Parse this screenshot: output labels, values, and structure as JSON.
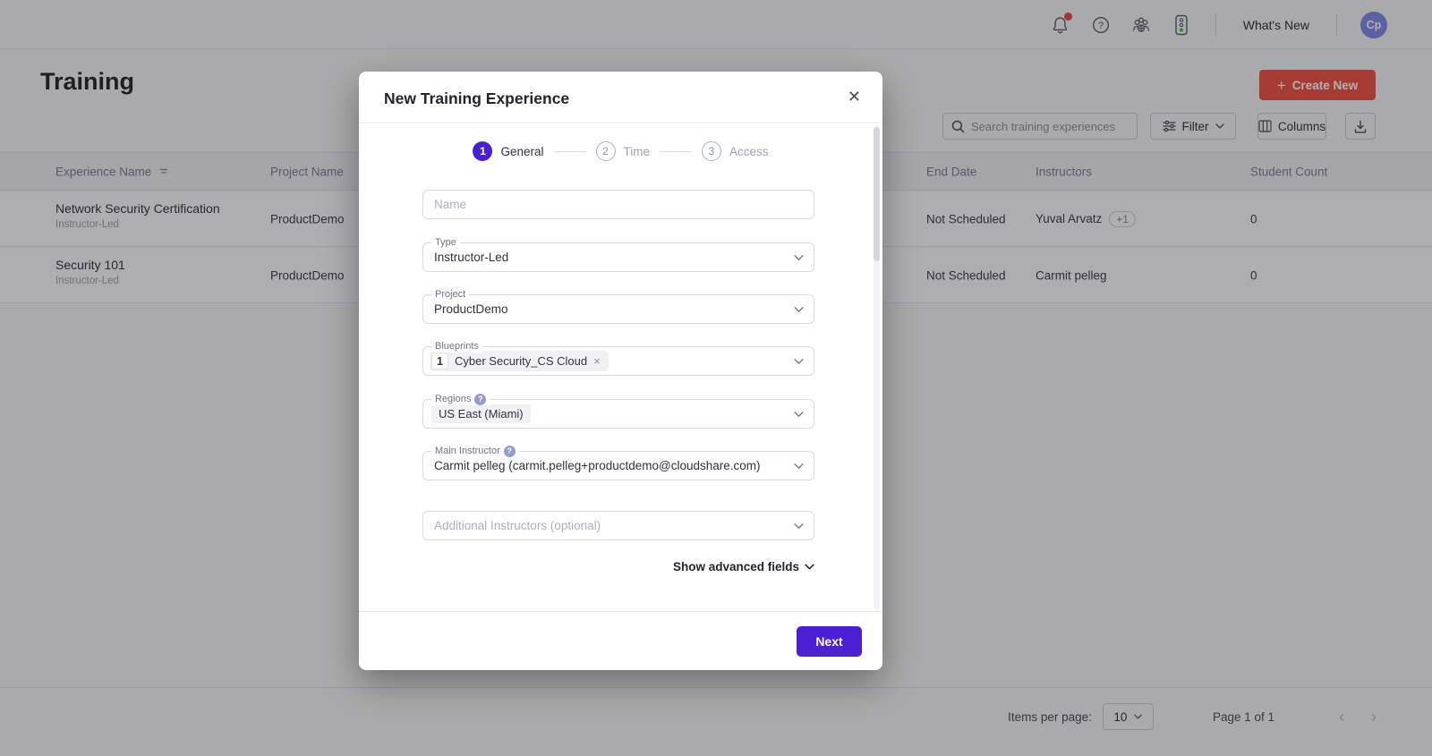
{
  "colors": {
    "accent_purple": "#4C20D2",
    "create_button_red": "#ED5243",
    "avatar_purple": "#8189E8",
    "notification_red": "#E8483C",
    "status_green": "#3FBE51"
  },
  "icons": {
    "close": "✕",
    "plus": "+",
    "chip_remove": "×",
    "help_badge": "?",
    "page_prev": "‹",
    "page_next": "›"
  },
  "topbar": {
    "whats_new": "What's New",
    "avatar_initials": "Cp"
  },
  "page": {
    "title": "Training",
    "create_button": "Create New"
  },
  "toolbar": {
    "search_placeholder": "Search training experiences",
    "filter_label": "Filter",
    "columns_label": "Columns"
  },
  "table": {
    "headers": {
      "experience": "Experience Name",
      "project": "Project Name",
      "end_date": "End Date",
      "instructors": "Instructors",
      "student_count": "Student Count"
    },
    "rows": [
      {
        "name": "Network Security Certification",
        "type": "Instructor-Led",
        "project": "ProductDemo",
        "end_date": "Not Scheduled",
        "instructor": "Yuval Arvatz",
        "extra_badge": "+1",
        "student_count": "0"
      },
      {
        "name": "Security 101",
        "type": "Instructor-Led",
        "project": "ProductDemo",
        "end_date": "Not Scheduled",
        "instructor": "Carmit pelleg",
        "student_count": "0"
      }
    ]
  },
  "pagination": {
    "items_per_page_label": "Items per page:",
    "items_per_page_value": "10",
    "page_info": "Page 1 of 1"
  },
  "modal": {
    "title": "New Training Experience",
    "steps": [
      {
        "number": "1",
        "label": "General"
      },
      {
        "number": "2",
        "label": "Time"
      },
      {
        "number": "3",
        "label": "Access"
      }
    ],
    "fields": {
      "name_placeholder": "Name",
      "type_label": "Type",
      "type_value": "Instructor-Led",
      "project_label": "Project",
      "project_value": "ProductDemo",
      "blueprints_label": "Blueprints",
      "blueprints_count": "1",
      "blueprints_chip": "Cyber Security_CS Cloud",
      "regions_label": "Regions",
      "regions_chip": "US East (Miami)",
      "main_instructor_label": "Main Instructor",
      "main_instructor_value": "Carmit pelleg (carmit.pelleg+productdemo@cloudshare.com)",
      "additional_placeholder": "Additional Instructors  (optional)"
    },
    "advanced_toggle": "Show advanced fields",
    "next_button": "Next"
  }
}
